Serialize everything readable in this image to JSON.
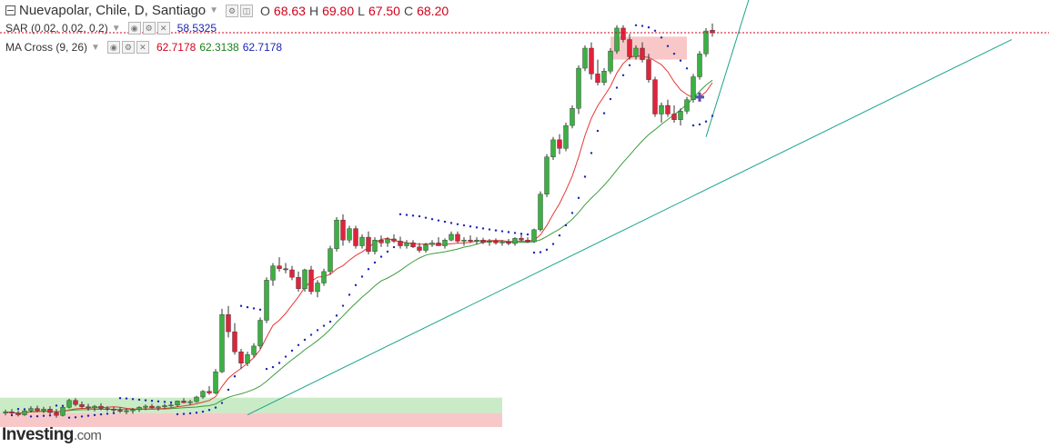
{
  "header": {
    "symbol_title": "Nuevapolar, Chile, D, Santiago",
    "ohlc": {
      "o_label": "O",
      "o_value": "68.63",
      "h_label": "H",
      "h_value": "69.80",
      "l_label": "L",
      "l_value": "67.50",
      "c_label": "C",
      "c_value": "68.20"
    }
  },
  "indicators": [
    {
      "name": "SAR (0.02, 0.02, 0.2)",
      "values": [
        "58.5325"
      ]
    },
    {
      "name": "MA Cross (9, 26)",
      "values": [
        "62.7178",
        "62.3138",
        "62.7178"
      ]
    }
  ],
  "branding": {
    "logo": "Investing",
    "suffix": ".com"
  },
  "colors": {
    "up": "#3cb043",
    "down": "#e0233a",
    "ma_fast": "#e53935",
    "ma_slow": "#3f9b3f",
    "sar": "#1b24b5",
    "trend": "#1aa38c",
    "support_zone": "#c9ecc6",
    "resistance_zone": "#f8c8c8",
    "price_line": "#d0021b"
  },
  "chart_data": {
    "type": "candlestick",
    "title": "Nuevapolar, Chile, D, Santiago",
    "ylim": [
      0,
      72
    ],
    "last_price": 68.2,
    "candles": [
      [
        1.8,
        2.4,
        1.4,
        2.0
      ],
      [
        2.0,
        2.5,
        1.5,
        1.8
      ],
      [
        1.8,
        2.2,
        1.2,
        1.5
      ],
      [
        1.5,
        2.4,
        1.3,
        2.2
      ],
      [
        2.2,
        3.0,
        1.9,
        2.6
      ],
      [
        2.6,
        3.1,
        2.0,
        2.2
      ],
      [
        2.2,
        2.9,
        1.8,
        2.5
      ],
      [
        2.5,
        3.0,
        1.6,
        1.9
      ],
      [
        1.9,
        2.5,
        1.0,
        1.4
      ],
      [
        1.4,
        3.0,
        1.2,
        2.8
      ],
      [
        2.8,
        4.3,
        2.6,
        4.0
      ],
      [
        4.0,
        4.4,
        3.0,
        3.3
      ],
      [
        3.3,
        3.8,
        2.6,
        2.9
      ],
      [
        2.9,
        3.4,
        2.2,
        2.7
      ],
      [
        2.7,
        3.2,
        2.1,
        3.0
      ],
      [
        3.0,
        3.5,
        2.3,
        2.6
      ],
      [
        2.6,
        3.0,
        2.1,
        2.5
      ],
      [
        2.5,
        2.9,
        2.0,
        2.3
      ],
      [
        2.3,
        2.8,
        1.8,
        2.1
      ],
      [
        2.1,
        2.6,
        1.6,
        2.2
      ],
      [
        2.2,
        2.7,
        1.7,
        2.4
      ],
      [
        2.4,
        3.0,
        2.0,
        2.8
      ],
      [
        2.8,
        3.3,
        2.3,
        3.0
      ],
      [
        3.0,
        3.4,
        2.6,
        2.7
      ],
      [
        2.7,
        3.1,
        2.2,
        2.9
      ],
      [
        2.9,
        3.4,
        2.5,
        3.1
      ],
      [
        3.1,
        3.6,
        2.8,
        3.2
      ],
      [
        3.2,
        4.0,
        2.9,
        3.9
      ],
      [
        3.9,
        4.4,
        3.5,
        3.6
      ],
      [
        3.6,
        4.1,
        3.2,
        3.8
      ],
      [
        3.8,
        4.8,
        3.6,
        4.6
      ],
      [
        4.6,
        5.8,
        4.3,
        5.6
      ],
      [
        5.6,
        6.5,
        5.0,
        5.3
      ],
      [
        5.3,
        9.5,
        5.1,
        9.0
      ],
      [
        9.0,
        20.0,
        8.8,
        19.0
      ],
      [
        19.0,
        20.5,
        15.0,
        16.0
      ],
      [
        16.0,
        17.5,
        12.0,
        12.5
      ],
      [
        12.5,
        13.0,
        9.5,
        10.5
      ],
      [
        10.5,
        12.5,
        10.0,
        12.0
      ],
      [
        12.0,
        14.0,
        11.5,
        13.5
      ],
      [
        13.5,
        18.5,
        13.0,
        18.0
      ],
      [
        18.0,
        25.5,
        17.5,
        25.0
      ],
      [
        25.0,
        28.0,
        24.0,
        27.5
      ],
      [
        27.5,
        29.0,
        26.5,
        27.0
      ],
      [
        27.0,
        28.0,
        26.2,
        26.8
      ],
      [
        26.8,
        27.5,
        25.0,
        25.5
      ],
      [
        25.5,
        26.5,
        23.0,
        23.5
      ],
      [
        23.5,
        27.0,
        23.0,
        26.8
      ],
      [
        26.8,
        27.5,
        22.5,
        23.0
      ],
      [
        23.0,
        25.0,
        22.0,
        24.5
      ],
      [
        24.5,
        27.0,
        24.0,
        26.5
      ],
      [
        26.5,
        31.0,
        26.0,
        30.5
      ],
      [
        30.5,
        36.0,
        30.0,
        35.5
      ],
      [
        35.5,
        36.5,
        31.0,
        32.0
      ],
      [
        32.0,
        34.5,
        31.5,
        34.0
      ],
      [
        34.0,
        34.5,
        30.5,
        31.0
      ],
      [
        31.0,
        33.0,
        30.5,
        32.5
      ],
      [
        32.5,
        33.5,
        29.5,
        30.0
      ],
      [
        30.0,
        32.5,
        29.5,
        32.0
      ],
      [
        32.0,
        32.8,
        30.8,
        31.5
      ],
      [
        31.5,
        32.5,
        30.8,
        32.2
      ],
      [
        32.2,
        33.0,
        31.5,
        31.8
      ],
      [
        31.8,
        32.6,
        30.5,
        31.0
      ],
      [
        31.0,
        32.0,
        30.5,
        31.5
      ],
      [
        31.5,
        32.0,
        30.6,
        30.8
      ],
      [
        30.8,
        31.5,
        29.8,
        30.2
      ],
      [
        30.2,
        31.5,
        29.8,
        31.2
      ],
      [
        31.2,
        32.0,
        30.8,
        31.5
      ],
      [
        31.5,
        32.5,
        31.0,
        31.0
      ],
      [
        31.0,
        32.3,
        30.5,
        32.0
      ],
      [
        32.0,
        33.5,
        31.8,
        33.0
      ],
      [
        33.0,
        33.5,
        31.5,
        31.8
      ],
      [
        31.8,
        32.5,
        31.0,
        32.0
      ],
      [
        32.0,
        32.8,
        31.5,
        31.8
      ],
      [
        31.8,
        32.5,
        31.2,
        32.0
      ],
      [
        32.0,
        32.4,
        31.3,
        31.6
      ],
      [
        31.6,
        32.2,
        31.0,
        31.8
      ],
      [
        31.8,
        32.3,
        31.2,
        31.5
      ],
      [
        31.5,
        32.0,
        31.0,
        31.7
      ],
      [
        31.7,
        32.2,
        31.1,
        31.4
      ],
      [
        31.4,
        32.5,
        31.0,
        32.3
      ],
      [
        32.3,
        33.0,
        31.8,
        32.0
      ],
      [
        32.0,
        32.5,
        31.5,
        31.7
      ],
      [
        31.7,
        34.0,
        31.5,
        33.8
      ],
      [
        33.8,
        40.5,
        33.5,
        40.0
      ],
      [
        40.0,
        47.0,
        39.5,
        46.5
      ],
      [
        46.5,
        50.0,
        46.0,
        49.5
      ],
      [
        49.5,
        50.5,
        47.0,
        48.0
      ],
      [
        48.0,
        52.5,
        47.5,
        52.0
      ],
      [
        52.0,
        55.5,
        51.5,
        55.0
      ],
      [
        55.0,
        62.5,
        54.0,
        62.0
      ],
      [
        62.0,
        66.0,
        61.5,
        65.5
      ],
      [
        65.5,
        66.5,
        60.0,
        61.0
      ],
      [
        61.0,
        63.5,
        59.0,
        59.5
      ],
      [
        59.5,
        62.0,
        59.0,
        61.5
      ],
      [
        61.5,
        65.5,
        61.0,
        65.0
      ],
      [
        65.0,
        69.5,
        64.5,
        69.0
      ],
      [
        69.0,
        69.5,
        66.5,
        67.0
      ],
      [
        67.0,
        68.0,
        63.5,
        64.0
      ],
      [
        64.0,
        66.0,
        63.5,
        65.5
      ],
      [
        65.5,
        66.5,
        63.0,
        63.5
      ],
      [
        63.5,
        64.5,
        59.5,
        60.0
      ],
      [
        60.0,
        60.5,
        53.5,
        54.0
      ],
      [
        54.0,
        56.0,
        52.5,
        55.5
      ],
      [
        55.5,
        56.5,
        53.5,
        54.0
      ],
      [
        54.0,
        55.5,
        52.5,
        53.0
      ],
      [
        53.0,
        55.0,
        52.0,
        54.5
      ],
      [
        54.5,
        57.0,
        54.0,
        56.5
      ],
      [
        56.5,
        61.0,
        56.0,
        60.5
      ],
      [
        60.5,
        65.0,
        60.0,
        64.5
      ],
      [
        64.5,
        69.0,
        64.0,
        68.5
      ],
      [
        68.63,
        69.8,
        67.5,
        68.2
      ]
    ],
    "sar_last": 58.5325,
    "ma_cross": {
      "fast_period": 9,
      "slow_period": 26,
      "values": [
        62.7178,
        62.3138,
        62.7178
      ]
    }
  }
}
